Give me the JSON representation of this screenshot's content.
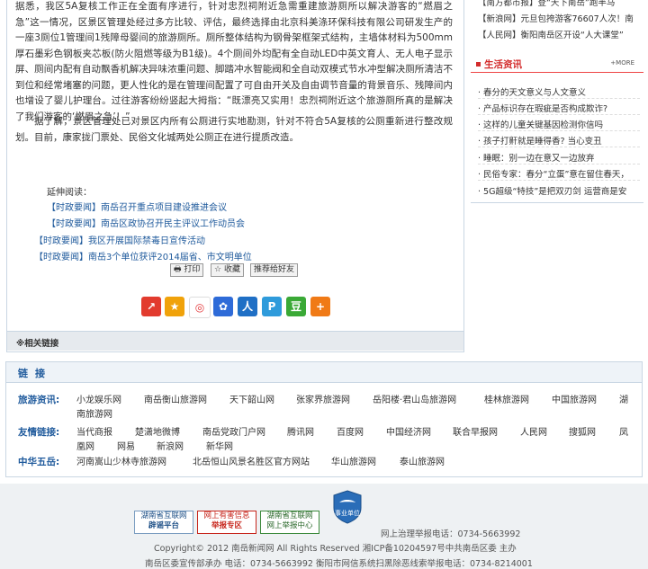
{
  "article": {
    "para1": "据悉，我区5A复核工作正在全面有序进行，针对忠烈祠附近急需重建旅游厕所以解决游客的“燃眉之急”这一情况，区景区管理处经过多方比较、评估，最终选择由北京科美涤环保科技有限公司研发生产的一座3厕位1管理间1残障母婴间的旅游厕所。厕所整体结构为钢骨架框架式结构，主墙体材料为500mm厚石墨彩色钢板夹芯板(防火阻燃等级为B1级)。4个厕间外均配有全自动LED中英文育人、无人电子显示屏、厕间内配有自动飘香机解决异味浓重问题、脚踏冲水智能阀和全自动双模式节水冲型解决厕所清洁不到位和经常堵塞的问题，更人性化的是在管理间配置了可自由开关及自由调节音量的背景音乐、残障间内也增设了婴儿护理台。过往游客纷纷竖起大拇指：“既漂亮又实用！忠烈祠附近这个旅游厕所真的是解决了我们游客的‘燃眉之急’！”",
    "para2": "据了解，景区管理处已对景区内所有公厕进行实地勘测，针对不符合5A复核的公厕重新进行整改规划。目前，康家拢门票处、民俗文化城两处公厕正在进行提质改造。",
    "ext_title": "延伸阅读：",
    "ext_links": [
      {
        "tag": "【时政要闻】",
        "text": "南岳召开重点项目建设推进会议"
      },
      {
        "tag": "【时政要闻】",
        "text": "南岳区政协召开民主评议工作动员会"
      },
      {
        "tag": "【时政要闻】",
        "text": "我区开展国际禁毒日宣传活动"
      },
      {
        "tag": "【时政要闻】",
        "text": "南岳3个单位获评2014届省、市文明单位"
      }
    ],
    "tools": {
      "print": "打印",
      "fav": "收藏",
      "recommend": "推荐给好友"
    },
    "related": "※相关链接"
  },
  "sidebar": {
    "top_items": [
      "【南方都市报】登“天下南岳”跑半马",
      "【新浪网】元旦包挎游客76607人次！南",
      "【人民网】衡阳南岳区开设“人大课堂”"
    ],
    "life_title": "生活资讯",
    "more": "MORE",
    "life_items": [
      "春分的天文意义与人文意义",
      "产品标识存在瑕疵是否构成欺诈?",
      "这样的儿童关键基因检测你信吗",
      "孩子打鼾就是睡得香? 当心变丑",
      "睡眠：别一边在意又一边放弃",
      "民俗专家：春分“立蛋”意在留住春天，",
      "5G超级“特技”是把双刃剑 运营商是安"
    ]
  },
  "links": {
    "title": "链接",
    "rows": [
      {
        "label": "旅游资讯:",
        "items": [
          "小龙娱乐网",
          "南岳衡山旅游网",
          "天下韶山网",
          "张家界旅游网",
          "岳阳楼·君山岛旅游网",
          "桂林旅游网",
          "中国旅游网",
          "湖",
          "南旅游网"
        ]
      },
      {
        "label": "友情链接:",
        "items": [
          "当代商报",
          "楚潇地微博",
          "南岳党政门户网",
          "腾讯网",
          "百度网",
          "中国经济网",
          "联合早报网",
          "人民网",
          "搜狐网",
          "凤",
          "凰网",
          "网易",
          "新浪网",
          "新华网"
        ]
      },
      {
        "label": "中华五岳:",
        "items": [
          "河南嵩山少林寺旅游网",
          "北岳恒山风景名胜区官方网站",
          "华山旅游网",
          "泰山旅游网"
        ]
      }
    ]
  },
  "footer": {
    "badge1a": "湖南省互联网",
    "badge1b": "辟谣平台",
    "badge2a": "网上有害信息",
    "badge2b": "举报专区",
    "badge3a": "湖南省互联网",
    "badge3b": "网上举报中心",
    "shield": "事业单位",
    "report": "网上治理举报电话：0734-5663992",
    "copyright": "Copyright© 2012 南岳新闻网 All Rights Reserved   湘ICP备10204597号中共南岳区委 主办",
    "contact": "南岳区委宣传部承办 电话：0734-5663992 衡阳市网信系统扫黑除恶线索举报电话：0734-8214001"
  },
  "colors": {
    "accent": "#1f5a9c",
    "life_red": "#d32b2b",
    "border": "#c9d6e3"
  }
}
